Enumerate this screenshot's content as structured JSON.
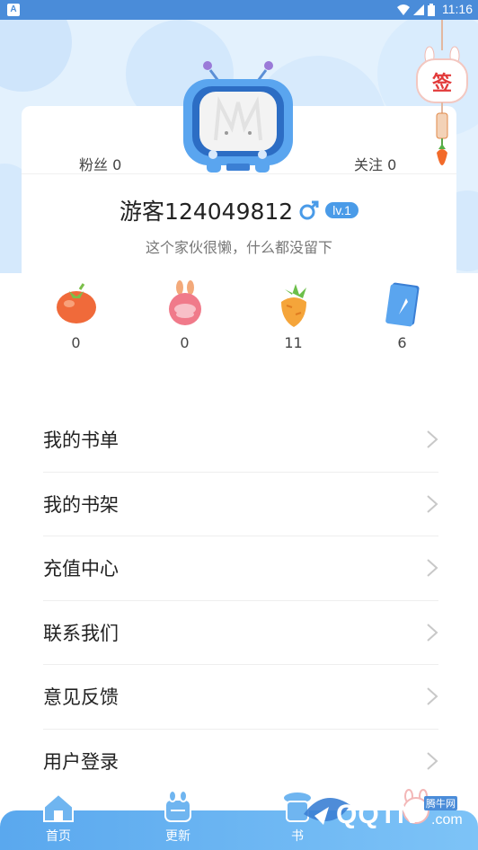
{
  "status_bar": {
    "time": "11:16",
    "app_badge": "A"
  },
  "profile": {
    "fans_label": "粉丝 0",
    "follow_label": "关注 0",
    "username": "游客124049812",
    "level": "lv.1",
    "bio": "这个家伙很懒，什么都没留下",
    "sign_label": "签"
  },
  "assets": [
    {
      "icon": "tomato-icon",
      "count": "0"
    },
    {
      "icon": "radish-icon",
      "count": "0"
    },
    {
      "icon": "carrot-icon",
      "count": "11"
    },
    {
      "icon": "card-icon",
      "count": "6"
    }
  ],
  "menu": [
    {
      "label": "我的书单"
    },
    {
      "label": "我的书架"
    },
    {
      "label": "充值中心"
    },
    {
      "label": "联系我们"
    },
    {
      "label": "意见反馈"
    },
    {
      "label": "用户登录"
    }
  ],
  "nav": [
    {
      "label": "首页",
      "icon": "home-icon"
    },
    {
      "label": "更新",
      "icon": "update-icon"
    },
    {
      "label": "书",
      "icon": "bookstore-icon"
    },
    {
      "label": "",
      "icon": "profile-icon"
    }
  ],
  "watermark": {
    "brand": "QQTN",
    "suffix": ".com",
    "cn": "腾牛网"
  },
  "colors": {
    "accent": "#4a9be8",
    "status_bar": "#4a8cd9",
    "hero_bg": "#e3f1fd"
  }
}
